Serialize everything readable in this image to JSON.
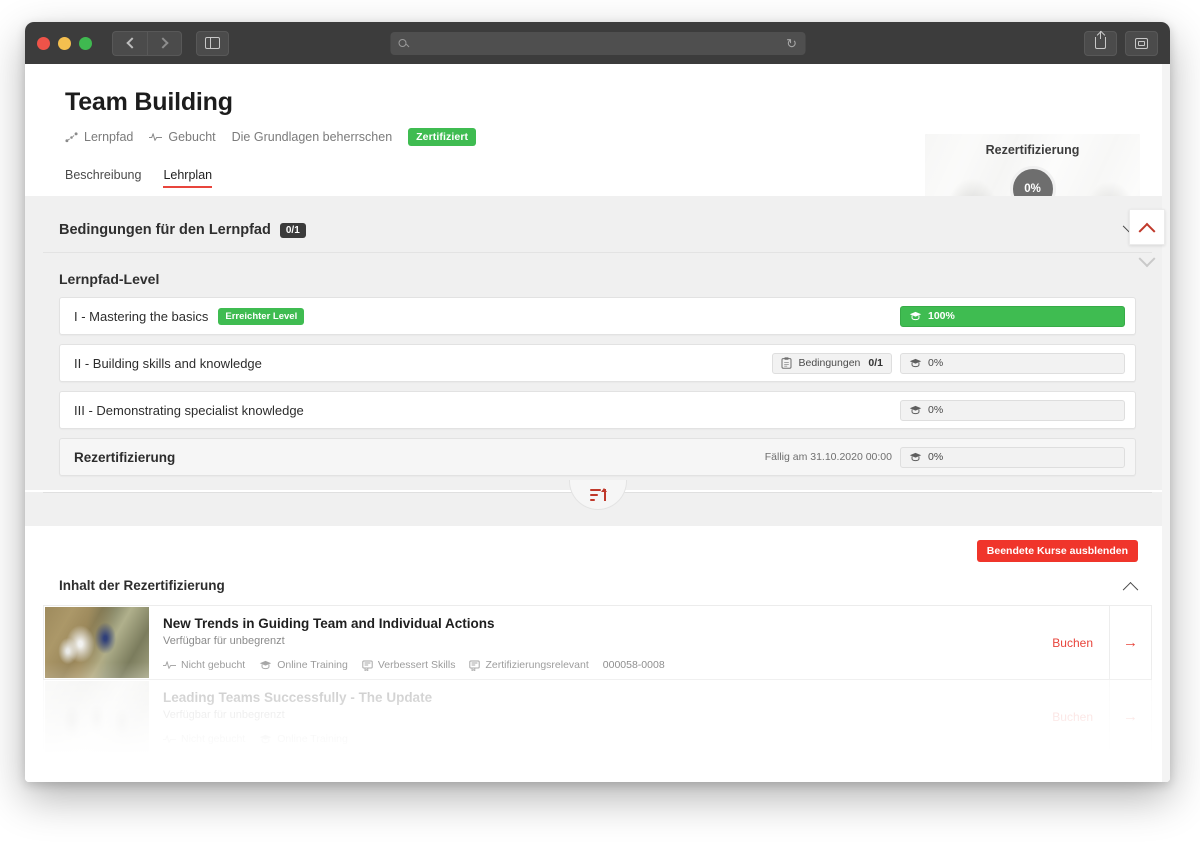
{
  "browser": {
    "url_placeholder": "",
    "reload_icon": "reload-icon",
    "search_icon": "search-icon",
    "back_icon": "back-icon",
    "forward_icon": "forward-icon",
    "sidebar_icon": "sidebar-icon",
    "share_icon": "share-icon",
    "tabs_icon": "tabs-icon"
  },
  "header": {
    "title": "Team Building",
    "meta": [
      {
        "icon": "learning-path-icon",
        "label": "Lernpfad"
      },
      {
        "icon": "pulse-icon",
        "label": "Gebucht"
      },
      {
        "icon": "",
        "label": "Die Grundlagen beherrschen"
      }
    ],
    "badge": "Zertifiziert"
  },
  "recert_card": {
    "title": "Rezertifizierung",
    "progress": "0%",
    "due": "Fällig am 31.10.2020 00:00"
  },
  "tabs": [
    {
      "label": "Beschreibung",
      "active": false
    },
    {
      "label": "Lehrplan",
      "active": true
    }
  ],
  "conditions": {
    "title": "Bedingungen für den Lernpfad",
    "count": "0/1",
    "chevron": "chevron-down-icon"
  },
  "levels_section": {
    "title": "Lernpfad-Level",
    "rows": [
      {
        "name": "I - Mastering the basics",
        "badge": "Erreichter Level",
        "progress": "100%",
        "full": true,
        "conditions_label": "",
        "conditions_count": "",
        "due": ""
      },
      {
        "name": "II - Building skills and knowledge",
        "badge": "",
        "progress": "0%",
        "full": false,
        "conditions_label": "Bedingungen",
        "conditions_count": "0/1",
        "due": ""
      },
      {
        "name": "III - Demonstrating specialist knowledge",
        "badge": "",
        "progress": "0%",
        "full": false,
        "conditions_label": "",
        "conditions_count": "",
        "due": ""
      },
      {
        "name": "Rezertifizierung",
        "badge": "",
        "progress": "0%",
        "full": false,
        "conditions_label": "",
        "conditions_count": "",
        "due": "Fällig am 31.10.2020 00:00"
      }
    ]
  },
  "divider": {
    "sort_icon": "sort-ascending-icon"
  },
  "content": {
    "hide_button": "Beendete Kurse ausblenden",
    "heading": "Inhalt der Rezertifizierung",
    "chevron": "chevron-up-icon",
    "courses": [
      {
        "title": "New Trends in Guiding Team and Individual Actions",
        "availability": "Verfügbar für unbegrenzt",
        "tags": [
          {
            "icon": "pulse-icon",
            "label": "Nicht gebucht"
          },
          {
            "icon": "graduation-cap-icon",
            "label": "Online Training"
          },
          {
            "icon": "certificate-icon",
            "label": "Verbessert Skills"
          },
          {
            "icon": "certificate-icon",
            "label": "Zertifizierungsrelevant"
          }
        ],
        "code": "000058-0008",
        "action": "Buchen",
        "arrow": "arrow-right-icon",
        "faded": false
      },
      {
        "title": "Leading Teams Successfully - The Update",
        "availability": "Verfügbar für unbegrenzt",
        "tags": [
          {
            "icon": "pulse-icon",
            "label": "Nicht gebucht"
          },
          {
            "icon": "graduation-cap-icon",
            "label": "Online Training"
          }
        ],
        "code": "",
        "action": "Buchen",
        "arrow": "arrow-right-icon",
        "faded": true
      }
    ]
  },
  "scroll": {
    "up": "chevron-up-icon",
    "down": "chevron-down-icon"
  },
  "colors": {
    "accent_red": "#e8453c",
    "button_red": "#f0352b",
    "green": "#3fbc51",
    "dark_pill": "#3b3b3b",
    "chrome": "#3c3c3c"
  }
}
